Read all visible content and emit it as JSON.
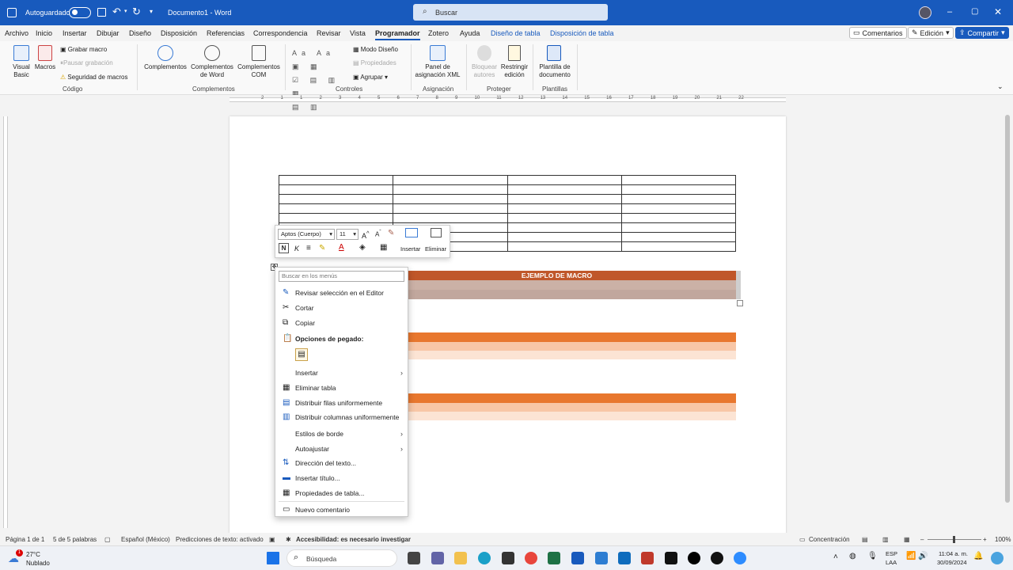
{
  "titlebar": {
    "autosave_label": "Autoguardado",
    "doc_title": "Documento1 - Word",
    "search_placeholder": "Buscar"
  },
  "tabs": [
    {
      "label": "Archivo"
    },
    {
      "label": "Inicio"
    },
    {
      "label": "Insertar"
    },
    {
      "label": "Dibujar"
    },
    {
      "label": "Diseño"
    },
    {
      "label": "Disposición"
    },
    {
      "label": "Referencias"
    },
    {
      "label": "Correspondencia"
    },
    {
      "label": "Revisar"
    },
    {
      "label": "Vista"
    },
    {
      "label": "Programador"
    },
    {
      "label": "Zotero"
    },
    {
      "label": "Ayuda"
    },
    {
      "label": "Diseño de tabla"
    },
    {
      "label": "Disposición de tabla"
    }
  ],
  "tab_buttons": {
    "comments": "Comentarios",
    "edit": "Edición",
    "share": "Compartir"
  },
  "ribbon": {
    "codigo": {
      "visual_basic": "Visual Basic",
      "macros": "Macros",
      "grabar": "Grabar macro",
      "pausar": "Pausar grabación",
      "seguridad": "Seguridad de macros",
      "group": "Código"
    },
    "complementos": {
      "complementos": "Complementos",
      "word": "Complementos de Word",
      "com": "Complementos COM",
      "group": "Complementos"
    },
    "controles": {
      "modo_diseno": "Modo Diseño",
      "propiedades": "Propiedades",
      "agrupar": "Agrupar",
      "group": "Controles"
    },
    "asignacion": {
      "panel": "Panel de asignación XML",
      "group": "Asignación"
    },
    "proteger": {
      "bloquear": "Bloquear autores",
      "restringir": "Restringir edición",
      "group": "Proteger"
    },
    "plantillas": {
      "plantilla": "Plantilla de documento",
      "group": "Plantillas"
    }
  },
  "ruler": {
    "numbers": [
      "2",
      "1",
      "1",
      "2",
      "3",
      "4",
      "5",
      "6",
      "7",
      "8",
      "9",
      "10",
      "11",
      "12",
      "13",
      "14",
      "15",
      "16",
      "17",
      "18",
      "19",
      "20",
      "21",
      "22"
    ]
  },
  "mini_toolbar": {
    "font": "Aptos (Cuerpo)",
    "size": "11",
    "insertar": "Insertar",
    "eliminar": "Eliminar",
    "bold": "N",
    "italic": "K"
  },
  "tables": {
    "macro_title": "EJEMPLO DE MACRO",
    "brand_color": "#c0572a",
    "orange": "#e8772e"
  },
  "context_menu": {
    "search_placeholder": "Buscar en los menús",
    "items": [
      {
        "label": "Revisar selección en el Editor",
        "icon": "editor-pen-icon"
      },
      {
        "label": "Cortar",
        "icon": "scissors-icon"
      },
      {
        "label": "Copiar",
        "icon": "copy-icon"
      },
      {
        "label": "Opciones de pegado:",
        "icon": "paste-icon"
      },
      {
        "label": "Insertar",
        "icon": ""
      },
      {
        "label": "Eliminar tabla",
        "icon": "delete-table-icon"
      },
      {
        "label": "Distribuir filas uniformemente",
        "icon": "distribute-rows-icon"
      },
      {
        "label": "Distribuir columnas uniformemente",
        "icon": "distribute-columns-icon"
      },
      {
        "label": "Estilos de borde",
        "icon": ""
      },
      {
        "label": "Autoajustar",
        "icon": ""
      },
      {
        "label": "Dirección del texto...",
        "icon": "text-direction-icon"
      },
      {
        "label": "Insertar título...",
        "icon": "insert-caption-icon"
      },
      {
        "label": "Propiedades de tabla...",
        "icon": "table-properties-icon"
      },
      {
        "label": "Nuevo comentario",
        "icon": "comment-icon"
      }
    ]
  },
  "statusbar": {
    "page": "Página 1 de 1",
    "words": "5 de 5 palabras",
    "language": "Español (México)",
    "predictions": "Predicciones de texto: activado",
    "accessibility": "Accesibilidad: es necesario investigar",
    "focus": "Concentración",
    "zoom": "100%"
  },
  "taskbar": {
    "weather_temp": "27°C",
    "weather_desc": "Nublado",
    "weather_badge": "1",
    "search": "Búsqueda",
    "lang_top": "ESP",
    "lang_bottom": "LAA",
    "time": "11:04 a. m.",
    "date": "30/09/2024"
  }
}
